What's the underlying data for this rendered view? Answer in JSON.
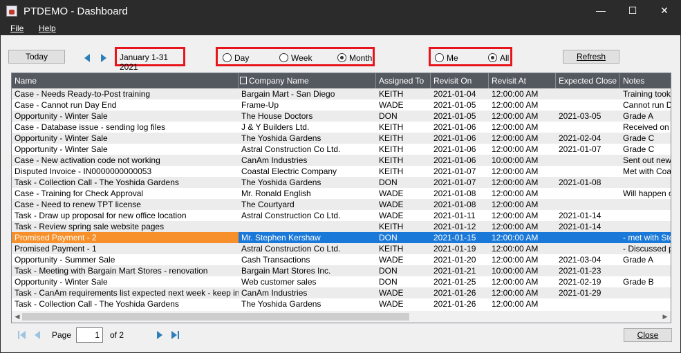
{
  "window": {
    "title": "PTDEMO - Dashboard",
    "minimize_glyph": "—",
    "maximize_glyph": "☐",
    "close_glyph": "✕"
  },
  "menu": {
    "file": "File",
    "help": "Help"
  },
  "toolbar": {
    "today": "Today",
    "date_range": "January 1-31 2021",
    "period": {
      "day": "Day",
      "week": "Week",
      "month": "Month",
      "selected": "Month"
    },
    "owner": {
      "me": "Me",
      "all": "All",
      "selected": "All"
    },
    "refresh": "Refresh"
  },
  "grid": {
    "columns": [
      "Name",
      "Company Name",
      "Assigned To",
      "Revisit On",
      "Revisit At",
      "Expected Close",
      "Notes"
    ],
    "rows": [
      [
        "Case - Needs Ready-to-Post training",
        "Bargain Mart - San Diego",
        "KEITH",
        "2021-01-04",
        "12:00:00 AM",
        "",
        "Training took p"
      ],
      [
        "Case - Cannot run Day End",
        "Frame-Up",
        "WADE",
        "2021-01-05",
        "12:00:00 AM",
        "",
        "Cannot run Day"
      ],
      [
        "Opportunity - Winter Sale",
        "The House Doctors",
        "DON",
        "2021-01-05",
        "12:00:00 AM",
        "2021-03-05",
        "Grade A"
      ],
      [
        "Case - Database issue - sending log files",
        "J & Y Builders Ltd.",
        "KEITH",
        "2021-01-06",
        "12:00:00 AM",
        "",
        "Received on Ja"
      ],
      [
        "Opportunity - Winter Sale",
        "The Yoshida Gardens",
        "KEITH",
        "2021-01-06",
        "12:00:00 AM",
        "2021-02-04",
        "Grade C"
      ],
      [
        "Opportunity - Winter Sale",
        "Astral Construction Co Ltd.",
        "KEITH",
        "2021-01-06",
        "12:00:00 AM",
        "2021-01-07",
        "Grade C"
      ],
      [
        "Case - New activation code not working",
        "CanAm Industries",
        "KEITH",
        "2021-01-06",
        "10:00:00 AM",
        "",
        "Sent out new c"
      ],
      [
        "Disputed Invoice - IN0000000000053",
        "Coastal Electric Company",
        "KEITH",
        "2021-01-07",
        "12:00:00 AM",
        "",
        "Met with Coasta"
      ],
      [
        "Task - Collection Call - The Yoshida Gardens",
        "The Yoshida Gardens",
        "DON",
        "2021-01-07",
        "12:00:00 AM",
        "2021-01-08",
        ""
      ],
      [
        "Case - Training for Check Approval",
        "Mr. Ronald English",
        "WADE",
        "2021-01-08",
        "12:00:00 AM",
        "",
        "Will happen on"
      ],
      [
        "Case - Need to renew TPT license",
        "The Courtyard",
        "WADE",
        "2021-01-08",
        "12:00:00 AM",
        "",
        ""
      ],
      [
        "Task - Draw up proposal for new office location",
        "Astral Construction Co Ltd.",
        "WADE",
        "2021-01-11",
        "12:00:00 AM",
        "2021-01-14",
        ""
      ],
      [
        "Task - Review spring sale website pages",
        "",
        "KEITH",
        "2021-01-12",
        "12:00:00 AM",
        "2021-01-14",
        ""
      ],
      [
        "Promised Payment - 2",
        "Mr. Stephen Kershaw",
        "DON",
        "2021-01-15",
        "12:00:00 AM",
        "",
        "- met with Steph"
      ],
      [
        "Promised Payment - 1",
        "Astral Construction Co Ltd.",
        "KEITH",
        "2021-01-19",
        "12:00:00 AM",
        "",
        "- Discussed pay"
      ],
      [
        "Opportunity - Summer Sale",
        "Cash Transactions",
        "WADE",
        "2021-01-20",
        "12:00:00 AM",
        "2021-03-04",
        "Grade A"
      ],
      [
        "Task - Meeting with Bargain Mart Stores - renovation",
        "Bargain Mart Stores Inc.",
        "DON",
        "2021-01-21",
        "10:00:00 AM",
        "2021-01-23",
        ""
      ],
      [
        "Opportunity - Winter Sale",
        "Web customer sales",
        "DON",
        "2021-01-25",
        "12:00:00 AM",
        "2021-02-19",
        "Grade B"
      ],
      [
        "Task - CanAm requirements list expected next week - keep in mind",
        "CanAm Industries",
        "WADE",
        "2021-01-26",
        "12:00:00 AM",
        "2021-01-29",
        ""
      ],
      [
        "Task - Collection Call - The Yoshida Gardens",
        "The Yoshida Gardens",
        "WADE",
        "2021-01-26",
        "12:00:00 AM",
        "",
        ""
      ]
    ],
    "selected_row": 13
  },
  "pager": {
    "page_label": "Page",
    "page_value": "1",
    "of_label": "of 2",
    "close": "Close"
  },
  "colors": {
    "selected_row": "#1a79d8",
    "selected_name_cell": "#f7902a",
    "highlight_box": "#e8141c",
    "header": "#54585f"
  }
}
